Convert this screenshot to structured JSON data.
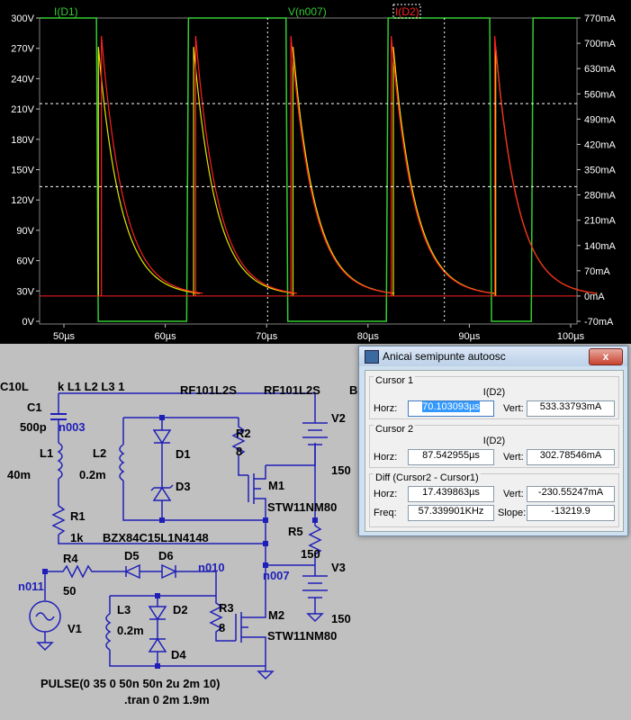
{
  "plot": {
    "traces": [
      {
        "label": "I(D1)",
        "color": "#33cc33"
      },
      {
        "label": "V(n007)",
        "color": "#33cc33"
      },
      {
        "label": "I(D2)",
        "color": "#ff2222"
      }
    ],
    "left_ticks": [
      "300V",
      "270V",
      "240V",
      "210V",
      "180V",
      "150V",
      "120V",
      "90V",
      "60V",
      "30V",
      "0V"
    ],
    "right_ticks": [
      "770mA",
      "700mA",
      "630mA",
      "560mA",
      "490mA",
      "420mA",
      "350mA",
      "280mA",
      "210mA",
      "140mA",
      "70mA",
      "0mA",
      "-70mA"
    ],
    "x_ticks": [
      "50µs",
      "60µs",
      "70µs",
      "80µs",
      "90µs",
      "100µs"
    ],
    "colors": {
      "background": "#000000",
      "grid": "#404040",
      "green": "#33cc33",
      "yellow": "#e6e600",
      "red": "#ff2020"
    }
  },
  "schematic": {
    "labels": {
      "c10l": "C10L",
      "kl": "k L1 L2 L3 1",
      "rf1": "RF101L2S",
      "rf2": "RF101L2S",
      "b": "B",
      "c1": "C1",
      "c1v": "500p",
      "n003": "n003",
      "l1": "L1",
      "l1v": "40m",
      "l2": "L2",
      "l2v": "0.2m",
      "d1": "D1",
      "d3": "D3",
      "r2": "R2",
      "r2v": "8",
      "m1": "M1",
      "m1v": "STW11NM80",
      "v2": "V2",
      "v2v": "150",
      "r1": "R1",
      "r1v": "1k",
      "bzx": "BZX84C15L1N4148",
      "r5": "R5",
      "r5v": "150",
      "r4": "R4",
      "r4v": "50",
      "d5": "D5",
      "d6": "D6",
      "n010": "n010",
      "n007": "n007",
      "v3": "V3",
      "v3v": "150",
      "n011": "n011",
      "v1": "V1",
      "l3": "L3",
      "l3v": "0.2m",
      "d2": "D2",
      "d4": "D4",
      "r3": "R3",
      "r3v": "8",
      "m2": "M2",
      "m2v": "STW11NM80",
      "pulse": "PULSE(0 35 0 50n 50n 2u 2m 10)",
      "tran": ".tran 0 2m 1.9m"
    }
  },
  "dialog": {
    "title": "Anicai semipunte autoosc",
    "close": "x",
    "cursor1": {
      "group": "Cursor 1",
      "trace": "I(D2)",
      "horz_label": "Horz:",
      "horz": "70.103093µs",
      "vert_label": "Vert:",
      "vert": "533.33793mA"
    },
    "cursor2": {
      "group": "Cursor 2",
      "trace": "I(D2)",
      "horz_label": "Horz:",
      "horz": "87.542955µs",
      "vert_label": "Vert:",
      "vert": "302.78546mA"
    },
    "diff": {
      "group": "Diff (Cursor2 - Cursor1)",
      "horz_label": "Horz:",
      "horz": "17.439863µs",
      "vert_label": "Vert:",
      "vert": "-230.55247mA",
      "freq_label": "Freq:",
      "freq": "57.339901KHz",
      "slope_label": "Slope:",
      "slope": "-13219.9"
    }
  }
}
